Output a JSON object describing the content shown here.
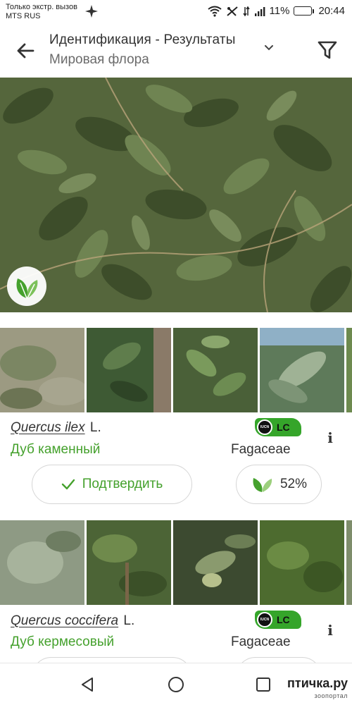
{
  "status_bar": {
    "carrier_line1": "Только экстр. вызов",
    "carrier_line2": "MTS RUS",
    "battery_percent": "11%",
    "battery_level": 0.11,
    "time": "20:44"
  },
  "app_bar": {
    "title": "Идентификация - Результаты",
    "subtitle": "Мировая флора",
    "icons": [
      "back-arrow-icon",
      "chevron-down-icon",
      "filter-icon"
    ]
  },
  "results": [
    {
      "latin_name": "Quercus ilex",
      "author": "L.",
      "common_name": "Дуб каменный",
      "family": "Fagaceae",
      "iucn_badge": "IUCN",
      "iucn_status": "LC",
      "confirm_label": "Подтвердить",
      "score": "52%",
      "info_label": "i"
    },
    {
      "latin_name": "Quercus coccifera",
      "author": "L.",
      "common_name": "Дуб кермесовый",
      "family": "Fagaceae",
      "iucn_badge": "IUCN",
      "iucn_status": "LC",
      "confirm_label": "",
      "score": "",
      "info_label": "i"
    }
  ],
  "colors": {
    "accent_green": "#45a12d",
    "iucn_green": "#35a52a",
    "text_dark": "#333333"
  },
  "watermark": {
    "text": "птичка.ру",
    "sub": "зоопортал"
  }
}
